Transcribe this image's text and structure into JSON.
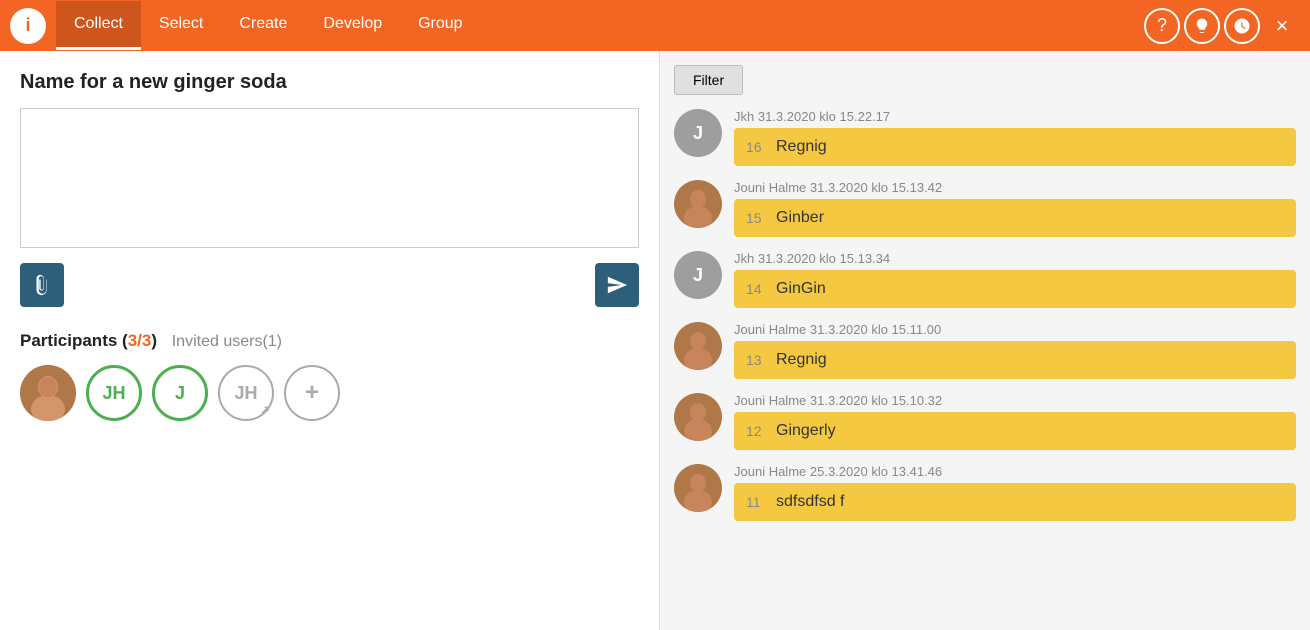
{
  "header": {
    "info_icon": "i",
    "tabs": [
      {
        "label": "Collect",
        "active": true
      },
      {
        "label": "Select",
        "active": false
      },
      {
        "label": "Create",
        "active": false
      },
      {
        "label": "Develop",
        "active": false
      },
      {
        "label": "Group",
        "active": false
      }
    ],
    "icons": [
      {
        "name": "help-icon",
        "symbol": "?"
      },
      {
        "name": "idea-icon",
        "symbol": "💡"
      },
      {
        "name": "clock-icon",
        "symbol": "🕐"
      }
    ],
    "close_label": "×"
  },
  "left": {
    "title": "Name for a new ginger soda",
    "input_placeholder": "",
    "attach_icon": "📎",
    "send_icon": "➤",
    "participants_label": "Participants",
    "participants_count": "3/3",
    "invited_label": "Invited users(1)",
    "avatars": [
      {
        "type": "photo",
        "initials": "",
        "label": "user-photo-1"
      },
      {
        "type": "initials-green",
        "initials": "JH",
        "label": "JH"
      },
      {
        "type": "initials-green",
        "initials": "J",
        "label": "J"
      },
      {
        "type": "initials-gray",
        "initials": "JH",
        "label": "JH-gray"
      },
      {
        "type": "add",
        "initials": "+",
        "label": "add"
      }
    ]
  },
  "right": {
    "filter_label": "Filter",
    "responses": [
      {
        "avatar_type": "initial",
        "avatar_label": "J",
        "meta": "Jkh 31.3.2020 klo 15.22.17",
        "number": "16",
        "text": "Regnig"
      },
      {
        "avatar_type": "photo",
        "avatar_label": "JH",
        "meta": "Jouni Halme 31.3.2020 klo 15.13.42",
        "number": "15",
        "text": "Ginber"
      },
      {
        "avatar_type": "initial",
        "avatar_label": "J",
        "meta": "Jkh 31.3.2020 klo 15.13.34",
        "number": "14",
        "text": "GinGin"
      },
      {
        "avatar_type": "photo",
        "avatar_label": "JH",
        "meta": "Jouni Halme 31.3.2020 klo 15.11.00",
        "number": "13",
        "text": "Regnig"
      },
      {
        "avatar_type": "photo",
        "avatar_label": "JH",
        "meta": "Jouni Halme 31.3.2020 klo 15.10.32",
        "number": "12",
        "text": "Gingerly"
      },
      {
        "avatar_type": "photo",
        "avatar_label": "JH",
        "meta": "Jouni Halme 25.3.2020 klo 13.41.46",
        "number": "11",
        "text": "sdfsdfsd f"
      }
    ]
  }
}
